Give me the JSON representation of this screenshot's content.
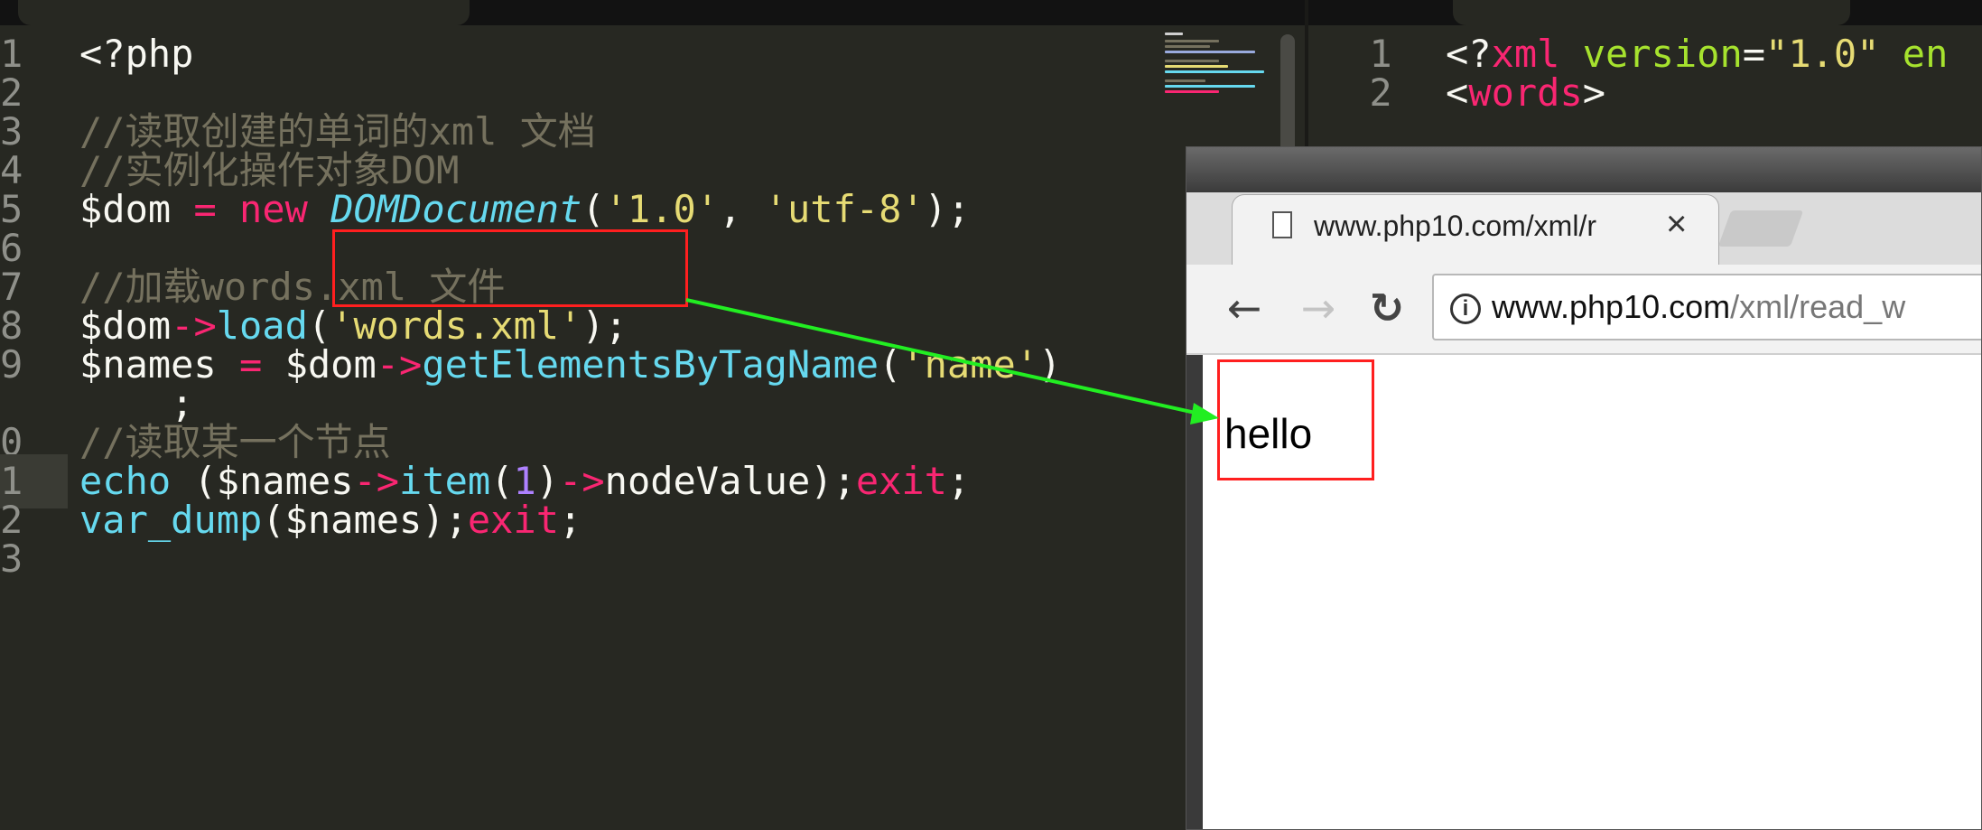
{
  "left_editor": {
    "lines": [
      {
        "num": "1",
        "tokens": [
          {
            "t": "<?php",
            "c": ""
          }
        ]
      },
      {
        "num": "2",
        "tokens": []
      },
      {
        "num": "3",
        "tokens": [
          {
            "t": "//读取创建的单词的xml 文档",
            "c": "com"
          }
        ]
      },
      {
        "num": "4",
        "tokens": [
          {
            "t": "//实例化操作对象DOM",
            "c": "com"
          }
        ]
      },
      {
        "num": "5",
        "tokens": [
          {
            "t": "$dom ",
            "c": ""
          },
          {
            "t": "=",
            "c": "kw"
          },
          {
            "t": " ",
            "c": ""
          },
          {
            "t": "new",
            "c": "kw"
          },
          {
            "t": " ",
            "c": ""
          },
          {
            "t": "DOMDocument",
            "c": "cls"
          },
          {
            "t": "(",
            "c": ""
          },
          {
            "t": "'1.0'",
            "c": "str"
          },
          {
            "t": ", ",
            "c": ""
          },
          {
            "t": "'utf-8'",
            "c": "str"
          },
          {
            "t": ");",
            "c": ""
          }
        ]
      },
      {
        "num": "6",
        "tokens": []
      },
      {
        "num": "7",
        "tokens": [
          {
            "t": "//加载words.xml 文件",
            "c": "com"
          }
        ]
      },
      {
        "num": "8",
        "tokens": [
          {
            "t": "$dom",
            "c": ""
          },
          {
            "t": "->",
            "c": "kw"
          },
          {
            "t": "load",
            "c": "fn"
          },
          {
            "t": "(",
            "c": ""
          },
          {
            "t": "'words.xml'",
            "c": "str"
          },
          {
            "t": ");",
            "c": ""
          }
        ]
      },
      {
        "num": "9",
        "tokens": [
          {
            "t": "$names ",
            "c": ""
          },
          {
            "t": "=",
            "c": "kw"
          },
          {
            "t": " $dom",
            "c": ""
          },
          {
            "t": "->",
            "c": "kw"
          },
          {
            "t": "getElementsByTagName",
            "c": "fn"
          },
          {
            "t": "(",
            "c": ""
          },
          {
            "t": "'name'",
            "c": "str"
          },
          {
            "t": ")",
            "c": ""
          }
        ]
      },
      {
        "num": "",
        "tokens": [
          {
            "t": "    ;",
            "c": ""
          }
        ]
      },
      {
        "num": "0",
        "tokens": [
          {
            "t": "//读取某一个节点",
            "c": "com"
          }
        ]
      },
      {
        "num": "1",
        "active": true,
        "tokens": [
          {
            "t": "echo",
            "c": "fn"
          },
          {
            "t": " ($names",
            "c": ""
          },
          {
            "t": "->",
            "c": "kw"
          },
          {
            "t": "item",
            "c": "fn"
          },
          {
            "t": "(",
            "c": ""
          },
          {
            "t": "1",
            "c": "num"
          },
          {
            "t": ")",
            "c": ""
          },
          {
            "t": "->",
            "c": "kw"
          },
          {
            "t": "nodeValue);",
            "c": ""
          },
          {
            "t": "exit",
            "c": "kw"
          },
          {
            "t": ";",
            "c": ""
          }
        ]
      },
      {
        "num": "2",
        "tokens": [
          {
            "t": "var_dump",
            "c": "fn"
          },
          {
            "t": "($names);",
            "c": ""
          },
          {
            "t": "exit",
            "c": "kw"
          },
          {
            "t": ";",
            "c": ""
          }
        ]
      },
      {
        "num": "3",
        "tokens": []
      }
    ]
  },
  "right_editor": {
    "lines": [
      {
        "num": "1",
        "tokens": [
          {
            "t": "<?",
            "c": ""
          },
          {
            "t": "xml",
            "c": "tag"
          },
          {
            "t": " ",
            "c": ""
          },
          {
            "t": "version",
            "c": "attr"
          },
          {
            "t": "=",
            "c": ""
          },
          {
            "t": "\"1.0\"",
            "c": "str"
          },
          {
            "t": " ",
            "c": ""
          },
          {
            "t": "en",
            "c": "attr"
          }
        ]
      },
      {
        "num": "2",
        "tokens": [
          {
            "t": "<",
            "c": ""
          },
          {
            "t": "words",
            "c": "tag"
          },
          {
            "t": ">",
            "c": ""
          }
        ]
      }
    ]
  },
  "browser": {
    "tab_title": "www.php10.com/xml/r",
    "tab_close": "×",
    "back_icon": "←",
    "forward_icon": "→",
    "reload_icon": "↻",
    "info_icon": "i",
    "url_domain": "www.php10.com",
    "url_path": "/xml/read_w",
    "page_text": "hello"
  },
  "colors": {
    "editor_bg": "#272822",
    "comment": "#75715e",
    "keyword": "#f92672",
    "function": "#66d9ef",
    "string": "#e6db74",
    "number": "#ae81ff",
    "highlight_box": "#ff1f1f",
    "arrow": "#22ee22"
  }
}
